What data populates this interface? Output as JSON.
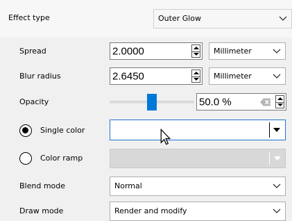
{
  "effect_type": {
    "label": "Effect type",
    "value": "Outer Glow"
  },
  "spread": {
    "label": "Spread",
    "value": "2.0000",
    "unit": "Millimeter"
  },
  "blur_radius": {
    "label": "Blur radius",
    "value": "2.6450",
    "unit": "Millimeter"
  },
  "opacity": {
    "label": "Opacity",
    "value": "50.0 %",
    "level": 0.5
  },
  "single_color": {
    "label": "Single color",
    "selected": true
  },
  "color_ramp": {
    "label": "Color ramp",
    "selected": false
  },
  "blend_mode": {
    "label": "Blend mode",
    "value": "Normal"
  },
  "draw_mode": {
    "label": "Draw mode",
    "value": "Render and modify"
  },
  "colors": {
    "accent": "#0078d7",
    "background": "#f0f0f0"
  },
  "icons": [
    "chevron-down-icon",
    "spin-up-icon",
    "spin-down-icon",
    "clear-icon",
    "mouse-cursor-icon"
  ]
}
